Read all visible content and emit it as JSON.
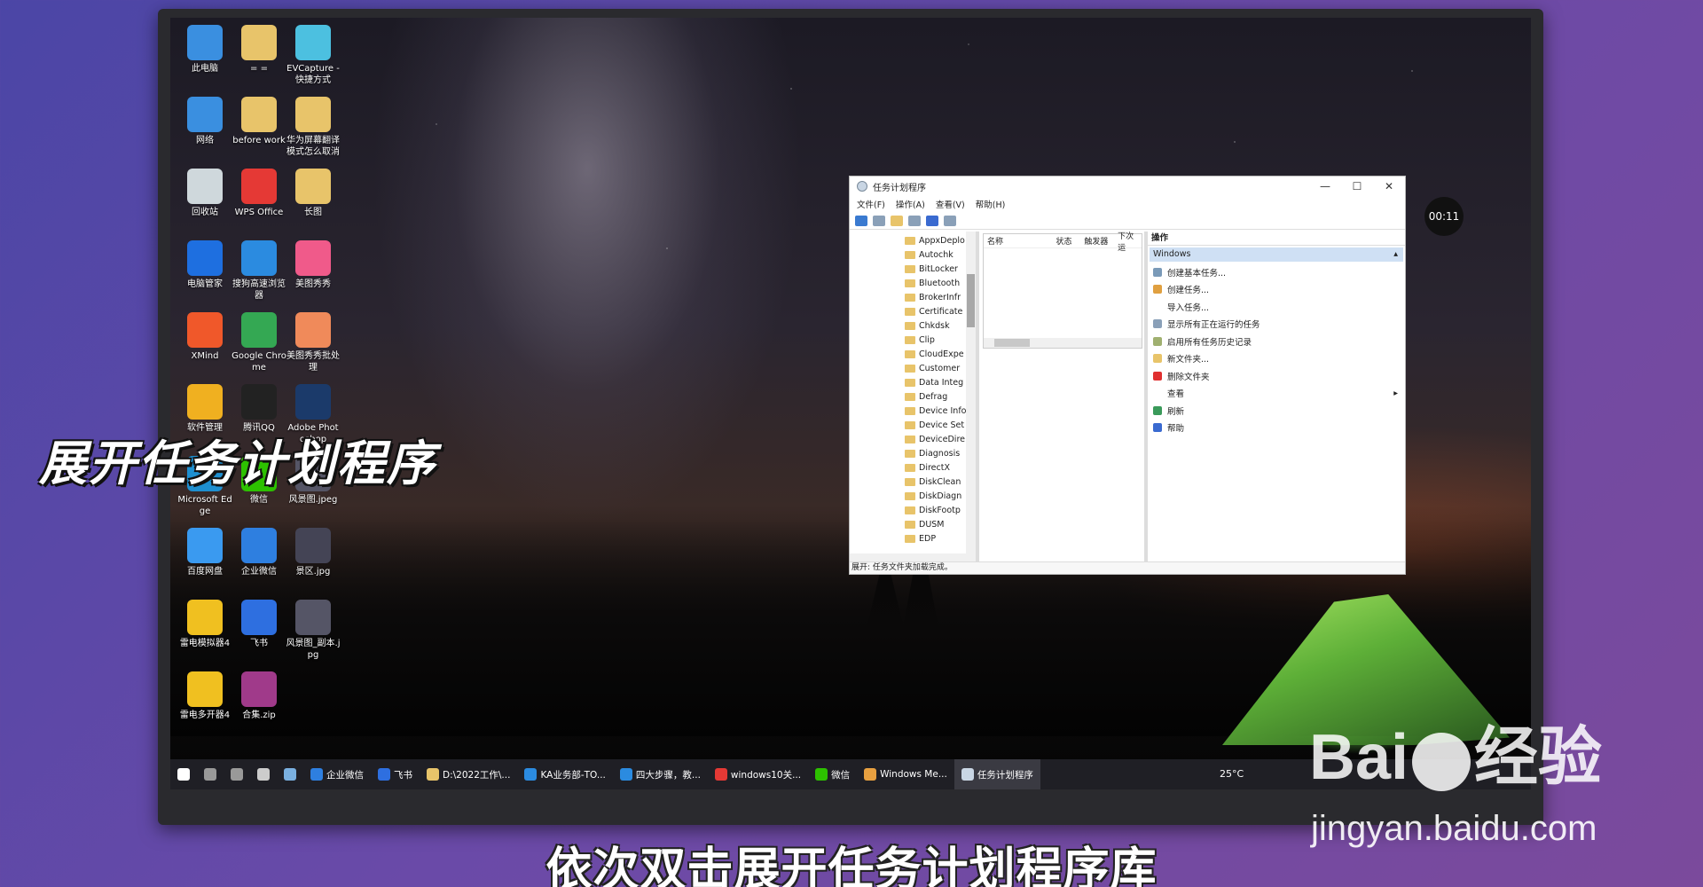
{
  "overlay_title": "展开任务计划程序",
  "subtitle": "依次双击展开任务计划程序库",
  "watermark": {
    "brand": "Bai",
    "brand2": "经验",
    "url": "jingyan.baidu.com"
  },
  "timer": "00:11",
  "desktop_icons": [
    {
      "label": "此电脑",
      "color": "#3a8fe0"
    },
    {
      "label": "= =",
      "color": "#e8c46a"
    },
    {
      "label": "EVCapture - 快捷方式",
      "color": "#4cc0e0"
    },
    {
      "label": "网络",
      "color": "#3a8fe0"
    },
    {
      "label": "before work",
      "color": "#e8c46a"
    },
    {
      "label": "华为屏幕翻译模式怎么取消",
      "color": "#e8c46a"
    },
    {
      "label": "回收站",
      "color": "#cfd8dc"
    },
    {
      "label": "WPS Office",
      "color": "#e53935"
    },
    {
      "label": "长图",
      "color": "#e8c46a"
    },
    {
      "label": "电脑管家",
      "color": "#1e6fe0"
    },
    {
      "label": "搜狗高速浏览器",
      "color": "#2b8be0"
    },
    {
      "label": "美图秀秀",
      "color": "#f05a8a"
    },
    {
      "label": "XMind",
      "color": "#f0582a"
    },
    {
      "label": "Google Chrome",
      "color": "#34a853"
    },
    {
      "label": "美图秀秀批处理",
      "color": "#f08a5a"
    },
    {
      "label": "软件管理",
      "color": "#f0b020"
    },
    {
      "label": "腾讯QQ",
      "color": "#222"
    },
    {
      "label": "Adobe Photoshop",
      "color": "#1b3a6a"
    },
    {
      "label": "Microsoft Edge",
      "color": "#1e8fd0"
    },
    {
      "label": "微信",
      "color": "#2dc100"
    },
    {
      "label": "风景图.jpeg",
      "color": "#556"
    },
    {
      "label": "百度网盘",
      "color": "#3a9af0"
    },
    {
      "label": "企业微信",
      "color": "#2e7fe0"
    },
    {
      "label": "景区.jpg",
      "color": "#445"
    },
    {
      "label": "雷电模拟器4",
      "color": "#f0c020"
    },
    {
      "label": "飞书",
      "color": "#2e6fe0"
    },
    {
      "label": "风景图_副本.jpg",
      "color": "#556"
    },
    {
      "label": "雷电多开器4",
      "color": "#f0c020"
    },
    {
      "label": "合集.zip",
      "color": "#a03a8a"
    }
  ],
  "window": {
    "title": "任务计划程序",
    "controls": {
      "minimize": "—",
      "maximize": "☐",
      "close": "✕"
    },
    "menu": [
      "文件(F)",
      "操作(A)",
      "查看(V)",
      "帮助(H)"
    ],
    "tree_items": [
      "AppxDeplo",
      "Autochk",
      "BitLocker",
      "Bluetooth",
      "BrokerInfr",
      "Certificate",
      "Chkdsk",
      "Clip",
      "CloudExpe",
      "Customer",
      "Data Integ",
      "Defrag",
      "Device Info",
      "Device Set",
      "DeviceDire",
      "Diagnosis",
      "DirectX",
      "DiskClean",
      "DiskDiagn",
      "DiskFootp",
      "DUSM",
      "EDP"
    ],
    "mid_columns": [
      "名称",
      "状态",
      "触发器",
      "下次运"
    ],
    "actions_header": "操作",
    "actions_section": "Windows",
    "actions": [
      {
        "label": "创建基本任务...",
        "color": "#7a9ab8"
      },
      {
        "label": "创建任务...",
        "color": "#e0a040"
      },
      {
        "label": "导入任务...",
        "color": "#ffffff"
      },
      {
        "label": "显示所有正在运行的任务",
        "color": "#8aa0b8"
      },
      {
        "label": "启用所有任务历史记录",
        "color": "#a0b070"
      },
      {
        "label": "新文件夹...",
        "color": "#e8c46a"
      },
      {
        "label": "删除文件夹",
        "color": "#e03030"
      },
      {
        "label": "查看",
        "color": "#ffffff"
      },
      {
        "label": "刷新",
        "color": "#3a9a5a"
      },
      {
        "label": "帮助",
        "color": "#3a6ad0"
      }
    ],
    "status": "展开: 任务文件夹加载完成。"
  },
  "taskbar": {
    "items": [
      {
        "label": "",
        "color": "#ffffff",
        "name": "start"
      },
      {
        "label": "",
        "color": "#999",
        "name": "search"
      },
      {
        "label": "",
        "color": "#999",
        "name": "task-view"
      },
      {
        "label": "",
        "color": "#ccc",
        "name": "calculator"
      },
      {
        "label": "",
        "color": "#7ab0e0",
        "name": "notes"
      },
      {
        "label": "企业微信",
        "color": "#2e7fe0",
        "name": "wecom"
      },
      {
        "label": "飞书",
        "color": "#2e6fe0",
        "name": "feishu"
      },
      {
        "label": "D:\\2022工作\\...",
        "color": "#e8c46a",
        "name": "explorer"
      },
      {
        "label": "KA业务部-TO...",
        "color": "#2b8be0",
        "name": "sogou-1"
      },
      {
        "label": "四大步骤，教...",
        "color": "#2b8be0",
        "name": "sogou-2"
      },
      {
        "label": "windows10关...",
        "color": "#e53935",
        "name": "wps"
      },
      {
        "label": "微信",
        "color": "#2dc100",
        "name": "wechat"
      },
      {
        "label": "Windows Me...",
        "color": "#e8a040",
        "name": "media"
      },
      {
        "label": "任务计划程序",
        "color": "#c9d6e4",
        "name": "task-scheduler"
      }
    ],
    "weather": "25°C"
  }
}
